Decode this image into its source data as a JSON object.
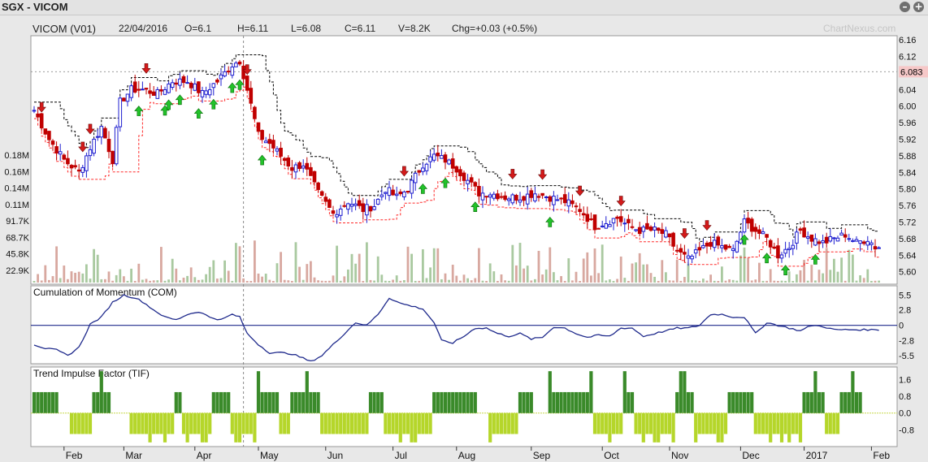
{
  "window": {
    "title": "SGX - VICOM",
    "minimize_icon": "minus-icon",
    "maximize_icon": "plus-icon"
  },
  "watermark": "ChartNexus.com",
  "colors": {
    "up": "#1f1fd0",
    "down": "#c00000",
    "com_line": "#1f2a8c",
    "tif_pos": "#3a8a2a",
    "tif_neg": "#b5d62a",
    "stop_upper": "#000000",
    "stop_lower": "#ff2a2a",
    "last_price_box": "#f6c8c8"
  },
  "info_bar": {
    "name": "VICOM (V01)",
    "date": "22/04/2016",
    "open": "O=6.1",
    "high": "H=6.11",
    "low": "L=6.08",
    "close": "C=6.11",
    "volume": "V=8.2K",
    "change": "Chg=+0.03 (+0.5%)"
  },
  "chart_data": [
    {
      "type": "candlestick",
      "panel": "price",
      "y_ticks": [
        "6.16",
        "6.12",
        "6.08",
        "6.04",
        "6.00",
        "5.96",
        "5.92",
        "5.88",
        "5.84",
        "5.80",
        "5.76",
        "5.72",
        "5.68",
        "5.64",
        "5.60"
      ],
      "ylim": [
        5.57,
        6.17
      ],
      "last_price_label": "6.083",
      "last_price": 6.083,
      "volume_ticks": [
        "0.18M",
        "0.16M",
        "0.14M",
        "0.11M",
        "91.7K",
        "68.7K",
        "45.8K",
        "22.9K"
      ],
      "months": [
        "Feb",
        "Mar",
        "Apr",
        "May",
        "Jun",
        "Jul",
        "Aug",
        "Sep",
        "Oct",
        "Nov",
        "Dec",
        "2017",
        "Feb"
      ],
      "month_index": [
        8,
        24,
        43,
        60,
        78,
        96,
        113,
        133,
        152,
        170,
        189,
        206,
        224
      ],
      "close_keypoints": [
        [
          0,
          5.99
        ],
        [
          4,
          5.92
        ],
        [
          8,
          5.87
        ],
        [
          12,
          5.84
        ],
        [
          15,
          5.9
        ],
        [
          18,
          5.95
        ],
        [
          21,
          5.87
        ],
        [
          23,
          6.01
        ],
        [
          26,
          6.04
        ],
        [
          29,
          6.04
        ],
        [
          33,
          6.03
        ],
        [
          37,
          6.06
        ],
        [
          41,
          6.06
        ],
        [
          45,
          6.03
        ],
        [
          49,
          6.06
        ],
        [
          53,
          6.1
        ],
        [
          55,
          6.11
        ],
        [
          57,
          6.04
        ],
        [
          60,
          5.93
        ],
        [
          63,
          5.91
        ],
        [
          66,
          5.88
        ],
        [
          69,
          5.85
        ],
        [
          72,
          5.86
        ],
        [
          76,
          5.79
        ],
        [
          80,
          5.74
        ],
        [
          84,
          5.77
        ],
        [
          88,
          5.75
        ],
        [
          91,
          5.76
        ],
        [
          94,
          5.8
        ],
        [
          97,
          5.78
        ],
        [
          100,
          5.8
        ],
        [
          104,
          5.86
        ],
        [
          107,
          5.88
        ],
        [
          110,
          5.87
        ],
        [
          113,
          5.85
        ],
        [
          116,
          5.82
        ],
        [
          119,
          5.79
        ],
        [
          122,
          5.79
        ],
        [
          126,
          5.78
        ],
        [
          130,
          5.78
        ],
        [
          134,
          5.79
        ],
        [
          138,
          5.78
        ],
        [
          142,
          5.77
        ],
        [
          146,
          5.75
        ],
        [
          150,
          5.71
        ],
        [
          153,
          5.72
        ],
        [
          156,
          5.73
        ],
        [
          159,
          5.71
        ],
        [
          162,
          5.7
        ],
        [
          166,
          5.7
        ],
        [
          169,
          5.69
        ],
        [
          172,
          5.65
        ],
        [
          175,
          5.63
        ],
        [
          178,
          5.65
        ],
        [
          181,
          5.67
        ],
        [
          184,
          5.66
        ],
        [
          187,
          5.65
        ],
        [
          190,
          5.72
        ],
        [
          193,
          5.7
        ],
        [
          196,
          5.68
        ],
        [
          199,
          5.64
        ],
        [
          202,
          5.66
        ],
        [
          205,
          5.7
        ],
        [
          208,
          5.68
        ],
        [
          211,
          5.67
        ],
        [
          214,
          5.68
        ],
        [
          217,
          5.69
        ],
        [
          220,
          5.67
        ],
        [
          223,
          5.68
        ],
        [
          225,
          5.66
        ]
      ],
      "up_arrow_index": [
        28,
        35,
        39,
        44,
        48,
        55,
        61,
        36,
        53,
        110,
        118,
        104,
        138,
        190,
        196,
        201,
        209
      ],
      "down_arrow_index": [
        2,
        13,
        15,
        30,
        57,
        99,
        128,
        136,
        146,
        157,
        174,
        180
      ],
      "series": [
        {
          "name": "VICOM (V01)"
        }
      ]
    },
    {
      "type": "line",
      "panel": "indicator",
      "title": "Cumulation of Momentum (COM)",
      "y_ticks": [
        "5.5",
        "2.8",
        "0",
        "-2.8",
        "-5.5"
      ],
      "ylim": [
        -7,
        7.2
      ],
      "keypoints": [
        [
          0,
          -3.5
        ],
        [
          3,
          -4.2
        ],
        [
          6,
          -4.5
        ],
        [
          9,
          -5.5
        ],
        [
          12,
          -4
        ],
        [
          15,
          0.2
        ],
        [
          18,
          1.5
        ],
        [
          21,
          4.2
        ],
        [
          24,
          5.5
        ],
        [
          27,
          5.0
        ],
        [
          29,
          4.3
        ],
        [
          32,
          2.8
        ],
        [
          35,
          1.5
        ],
        [
          38,
          1.0
        ],
        [
          41,
          2.0
        ],
        [
          44,
          2.5
        ],
        [
          47,
          1.5
        ],
        [
          50,
          1.0
        ],
        [
          53,
          2.0
        ],
        [
          55,
          1.5
        ],
        [
          57,
          -1.5
        ],
        [
          60,
          -3.5
        ],
        [
          63,
          -5.0
        ],
        [
          66,
          -5.0
        ],
        [
          69,
          -5.2
        ],
        [
          72,
          -6.0
        ],
        [
          74,
          -6.6
        ],
        [
          77,
          -5.5
        ],
        [
          80,
          -3.5
        ],
        [
          83,
          -1.5
        ],
        [
          86,
          0.5
        ],
        [
          89,
          0.0
        ],
        [
          92,
          2.0
        ],
        [
          95,
          5.0
        ],
        [
          98,
          4.0
        ],
        [
          101,
          3.5
        ],
        [
          104,
          3.0
        ],
        [
          107,
          0.5
        ],
        [
          109,
          -2.8
        ],
        [
          112,
          -3.2
        ],
        [
          115,
          -2.0
        ],
        [
          118,
          -0.5
        ],
        [
          121,
          -0.5
        ],
        [
          124,
          -1.5
        ],
        [
          127,
          -2.0
        ],
        [
          130,
          -1.5
        ],
        [
          133,
          -2.5
        ],
        [
          136,
          -2.2
        ],
        [
          139,
          -0.3
        ],
        [
          142,
          -0.5
        ],
        [
          145,
          -1.5
        ],
        [
          148,
          -2.2
        ],
        [
          151,
          -1.8
        ],
        [
          154,
          -2.0
        ],
        [
          157,
          -0.5
        ],
        [
          160,
          -0.5
        ],
        [
          163,
          -2.0
        ],
        [
          166,
          -1.5
        ],
        [
          169,
          -1.0
        ],
        [
          172,
          -0.5
        ],
        [
          175,
          -0.5
        ],
        [
          178,
          0.0
        ],
        [
          181,
          2.0
        ],
        [
          184,
          2.0
        ],
        [
          187,
          1.5
        ],
        [
          190,
          1.5
        ],
        [
          193,
          -1.5
        ],
        [
          196,
          0.5
        ],
        [
          199,
          0.0
        ],
        [
          202,
          -0.5
        ],
        [
          205,
          -1.0
        ],
        [
          208,
          0.0
        ],
        [
          211,
          -0.2
        ],
        [
          214,
          -0.8
        ]
      ]
    },
    {
      "type": "bar",
      "panel": "indicator",
      "title": "Trend Impulse Factor (TIF)",
      "y_ticks": [
        "1.6",
        "0.8",
        "0.0",
        "-0.8"
      ],
      "ylim": [
        -1.6,
        2.2
      ],
      "segments": [
        [
          0,
          7,
          1
        ],
        [
          7,
          10,
          0
        ],
        [
          10,
          16,
          -1
        ],
        [
          16,
          21,
          1
        ],
        [
          21,
          26,
          0
        ],
        [
          26,
          38,
          -1
        ],
        [
          38,
          40,
          1
        ],
        [
          40,
          48,
          -1
        ],
        [
          48,
          53,
          1
        ],
        [
          53,
          60,
          -1
        ],
        [
          60,
          66,
          1
        ],
        [
          66,
          69,
          -1
        ],
        [
          69,
          77,
          1
        ],
        [
          77,
          81,
          -1
        ],
        [
          81,
          90,
          -1
        ],
        [
          90,
          94,
          1
        ],
        [
          94,
          100,
          -1
        ],
        [
          100,
          107,
          -1
        ],
        [
          107,
          110,
          1
        ],
        [
          110,
          119,
          1
        ],
        [
          119,
          122,
          0
        ],
        [
          122,
          126,
          -1
        ],
        [
          126,
          130,
          -1
        ],
        [
          130,
          134,
          1
        ],
        [
          134,
          138,
          0
        ],
        [
          138,
          144,
          1
        ],
        [
          144,
          150,
          1
        ],
        [
          150,
          152,
          -1
        ],
        [
          152,
          158,
          -1
        ],
        [
          158,
          161,
          1
        ],
        [
          161,
          166,
          -1
        ],
        [
          166,
          172,
          -1
        ],
        [
          172,
          177,
          1
        ],
        [
          177,
          186,
          -1
        ],
        [
          186,
          193,
          1
        ],
        [
          193,
          197,
          -1
        ],
        [
          197,
          202,
          -1
        ],
        [
          202,
          206,
          -1
        ],
        [
          206,
          212,
          1
        ],
        [
          212,
          216,
          -1
        ],
        [
          216,
          222,
          1
        ]
      ]
    }
  ]
}
